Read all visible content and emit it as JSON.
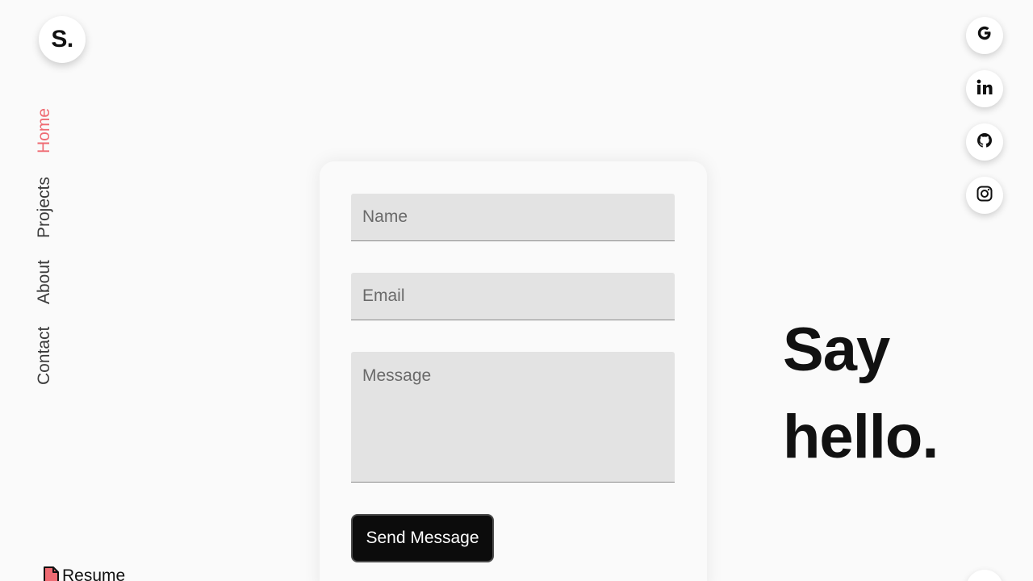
{
  "logo": {
    "text": "S."
  },
  "nav": {
    "items": [
      {
        "label": "Home",
        "active": true
      },
      {
        "label": "Projects",
        "active": false
      },
      {
        "label": "About",
        "active": false
      },
      {
        "label": "Contact",
        "active": false
      }
    ],
    "active_color": "#ef6b73"
  },
  "resume": {
    "label": "Resume",
    "icon": "file-icon",
    "icon_color": "#ef6b73"
  },
  "social": [
    {
      "name": "google",
      "icon": "google-icon"
    },
    {
      "name": "linkedin",
      "icon": "linkedin-icon"
    },
    {
      "name": "github",
      "icon": "github-icon"
    },
    {
      "name": "instagram",
      "icon": "instagram-icon"
    }
  ],
  "form": {
    "name": {
      "placeholder": "Name",
      "value": ""
    },
    "email": {
      "placeholder": "Email",
      "value": ""
    },
    "message": {
      "placeholder": "Message",
      "value": ""
    },
    "submit_label": "Send Message"
  },
  "hero": {
    "line1": "Say",
    "line2": "hello."
  }
}
